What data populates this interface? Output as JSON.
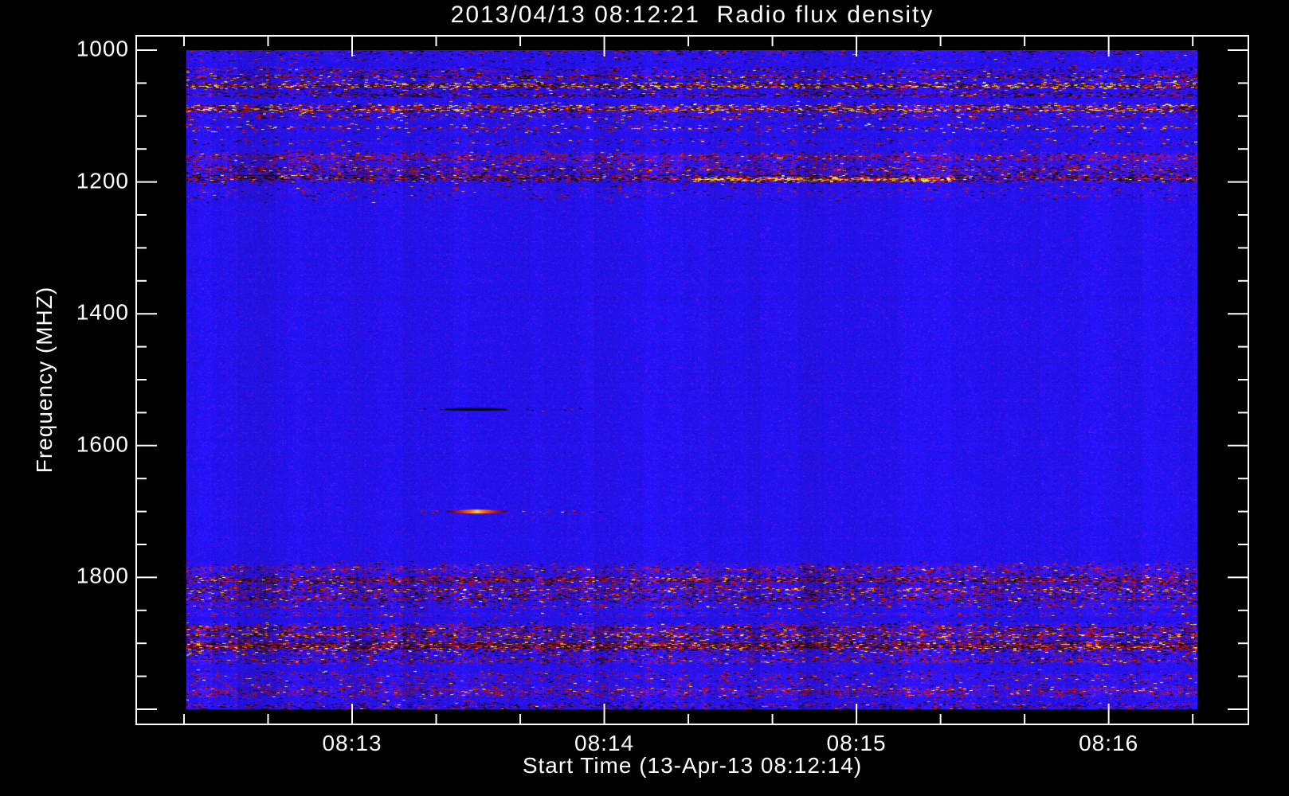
{
  "window": {
    "background_color": "#000000",
    "text_color": "#ffffff",
    "axis_color": "#ffffff"
  },
  "chart_data": {
    "type": "heatmap",
    "title": "2013/04/13 08:12:21  Radio flux density",
    "xlabel": "Start Time (13-Apr-13 08:12:14)",
    "ylabel": "Frequency (MHZ)",
    "x_tick_labels": [
      "08:13",
      "08:14",
      "08:15",
      "08:16"
    ],
    "y_tick_labels": [
      "1000",
      "1200",
      "1400",
      "1600",
      "1800"
    ],
    "y_tick_values": [
      1000,
      1200,
      1400,
      1600,
      1800
    ],
    "y_minor_step_mhz": 50,
    "x_minor_ticks_per_major": 3,
    "freq_range_mhz": [
      1000,
      2000
    ],
    "time_start": "08:12:21",
    "time_end": "08:16:21",
    "grid": false,
    "legend": null,
    "palette": {
      "base_blue": "#1c0fe6",
      "noise_purple": "#5a20c8",
      "speckle_dark": "#050505",
      "speckle_red": "#d21e04",
      "speckle_orange": "#ff8200",
      "speckle_yellow": "#ffd24a",
      "speckle_white": "#ffffff"
    },
    "rfi_bands": [
      {
        "freq_mhz": 1002,
        "sigma_mhz": 3.0,
        "dark": 0.12,
        "red": 0.07,
        "bright": 0.005,
        "wash": 0.1
      },
      {
        "freq_mhz": 1014,
        "sigma_mhz": 3.0,
        "dark": 0.05,
        "red": 0.04,
        "bright": 0.003,
        "wash": 0.07
      },
      {
        "freq_mhz": 1030,
        "sigma_mhz": 2.5,
        "dark": 0.2,
        "red": 0.15,
        "bright": 0.02,
        "wash": 0.16
      },
      {
        "freq_mhz": 1040,
        "sigma_mhz": 2.5,
        "dark": 0.26,
        "red": 0.2,
        "bright": 0.04,
        "wash": 0.2
      },
      {
        "freq_mhz": 1053,
        "sigma_mhz": 3.5,
        "dark": 0.5,
        "red": 0.26,
        "bright": 0.3,
        "wash": 0.26
      },
      {
        "freq_mhz": 1067,
        "sigma_mhz": 2.5,
        "dark": 0.4,
        "red": 0.13,
        "bright": 0.02,
        "wash": 0.2
      },
      {
        "freq_mhz": 1088,
        "sigma_mhz": 4.0,
        "dark": 0.25,
        "red": 0.28,
        "bright": 0.24,
        "wash": 0.28
      },
      {
        "freq_mhz": 1101,
        "sigma_mhz": 2.5,
        "dark": 0.09,
        "red": 0.16,
        "bright": 0.05,
        "wash": 0.14
      },
      {
        "freq_mhz": 1117,
        "sigma_mhz": 4.0,
        "dark": 0.05,
        "red": 0.09,
        "bright": 0.07,
        "wash": 0.1
      },
      {
        "freq_mhz": 1139,
        "sigma_mhz": 3.5,
        "dark": 0.05,
        "red": 0.1,
        "bright": 0.02,
        "wash": 0.1
      },
      {
        "freq_mhz": 1163,
        "sigma_mhz": 5.0,
        "dark": 0.11,
        "red": 0.24,
        "bright": 0.03,
        "wash": 0.3
      },
      {
        "freq_mhz": 1179,
        "sigma_mhz": 3.5,
        "dark": 0.2,
        "red": 0.24,
        "bright": 0.04,
        "wash": 0.26
      },
      {
        "freq_mhz": 1193,
        "sigma_mhz": 4.0,
        "dark": 0.48,
        "red": 0.24,
        "bright": 0.06,
        "wash": 0.28
      },
      {
        "freq_mhz": 1196,
        "sigma_mhz": 2.0,
        "dark": 0.05,
        "red": 0.22,
        "bright": 0.45,
        "wash": 0.1,
        "t_start": 0.5,
        "t_end": 0.76
      },
      {
        "freq_mhz": 1216,
        "sigma_mhz": 7.0,
        "dark": 0.03,
        "red": 0.04,
        "bright": 0.003,
        "wash": 0.09
      },
      {
        "freq_mhz": 1545,
        "sigma_mhz": 1.3,
        "dark": 0.1,
        "red": 0.02,
        "bright": 0.0,
        "wash": 0.02,
        "t_start": 0.23,
        "t_end": 0.4
      },
      {
        "freq_mhz": 1700,
        "sigma_mhz": 1.3,
        "dark": 0.02,
        "red": 0.1,
        "bright": 0.01,
        "wash": 0.02,
        "t_start": 0.23,
        "t_end": 0.42
      },
      {
        "freq_mhz": 1787,
        "sigma_mhz": 5.0,
        "dark": 0.08,
        "red": 0.18,
        "bright": 0.02,
        "wash": 0.22
      },
      {
        "freq_mhz": 1804,
        "sigma_mhz": 5.0,
        "dark": 0.28,
        "red": 0.24,
        "bright": 0.05,
        "wash": 0.28
      },
      {
        "freq_mhz": 1818,
        "sigma_mhz": 3.0,
        "dark": 0.24,
        "red": 0.28,
        "bright": 0.14,
        "wash": 0.28
      },
      {
        "freq_mhz": 1830,
        "sigma_mhz": 4.0,
        "dark": 0.24,
        "red": 0.2,
        "bright": 0.04,
        "wash": 0.24
      },
      {
        "freq_mhz": 1843,
        "sigma_mhz": 3.0,
        "dark": 0.07,
        "red": 0.12,
        "bright": 0.02,
        "wash": 0.14
      },
      {
        "freq_mhz": 1856,
        "sigma_mhz": 1.8,
        "dark": 0.04,
        "red": 0.15,
        "bright": 0.01,
        "wash": 0.16
      },
      {
        "freq_mhz": 1876,
        "sigma_mhz": 4.0,
        "dark": 0.24,
        "red": 0.24,
        "bright": 0.05,
        "wash": 0.26
      },
      {
        "freq_mhz": 1887,
        "sigma_mhz": 2.5,
        "dark": 0.22,
        "red": 0.26,
        "bright": 0.13,
        "wash": 0.26
      },
      {
        "freq_mhz": 1903,
        "sigma_mhz": 7.0,
        "dark": 0.4,
        "red": 0.28,
        "bright": 0.1,
        "wash": 0.3
      },
      {
        "freq_mhz": 1925,
        "sigma_mhz": 4.0,
        "dark": 0.11,
        "red": 0.18,
        "bright": 0.02,
        "wash": 0.2
      },
      {
        "freq_mhz": 1948,
        "sigma_mhz": 5.0,
        "dark": 0.04,
        "red": 0.09,
        "bright": 0.01,
        "wash": 0.12
      },
      {
        "freq_mhz": 1971,
        "sigma_mhz": 8.0,
        "dark": 0.07,
        "red": 0.18,
        "bright": 0.03,
        "wash": 0.24
      },
      {
        "freq_mhz": 1996,
        "sigma_mhz": 4.0,
        "dark": 0.2,
        "red": 0.11,
        "bright": 0.01,
        "wash": 0.12
      }
    ],
    "features": [
      {
        "name": "absorption-dash",
        "freq_mhz": 1545,
        "t_start": 0.255,
        "t_end": 0.318,
        "style": "dark"
      },
      {
        "name": "emission-dash",
        "freq_mhz": 1700,
        "t_start": 0.257,
        "t_end": 0.318,
        "style": "bright"
      }
    ]
  }
}
